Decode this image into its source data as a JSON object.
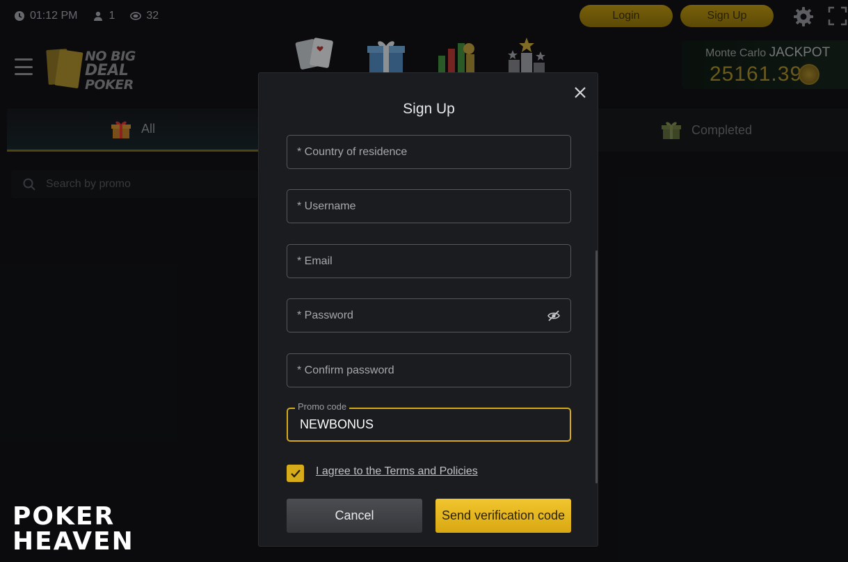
{
  "status": {
    "time": "01:12 PM",
    "players": "1",
    "tables": "32"
  },
  "header": {
    "login_label": "Login",
    "signup_label": "Sign Up"
  },
  "logo": {
    "line1": "NO BIG",
    "line2": "DEAL",
    "line3": "POKER"
  },
  "jackpot": {
    "prefix": "Monte Carlo",
    "label": "JACKPOT",
    "value": "25161.39"
  },
  "tabs": [
    {
      "label": "All"
    },
    {
      "label": "Completed"
    }
  ],
  "search": {
    "placeholder": "Search by promo"
  },
  "modal": {
    "title": "Sign Up",
    "fields": {
      "country": "* Country of residence",
      "username": "* Username",
      "email": "* Email",
      "password": "* Password",
      "confirm": "* Confirm password"
    },
    "promo_label": "Promo code",
    "promo_value": "NEWBONUS",
    "agree_label": "I agree to the Terms and Policies",
    "agree_checked": true,
    "cancel_label": "Cancel",
    "send_label": "Send verification code"
  },
  "watermark": {
    "line1": "POKER",
    "line2": "HEAVEN"
  },
  "colors": {
    "accent": "#d6ac1a",
    "background": "#111214",
    "modal": "#1b1c1f"
  }
}
